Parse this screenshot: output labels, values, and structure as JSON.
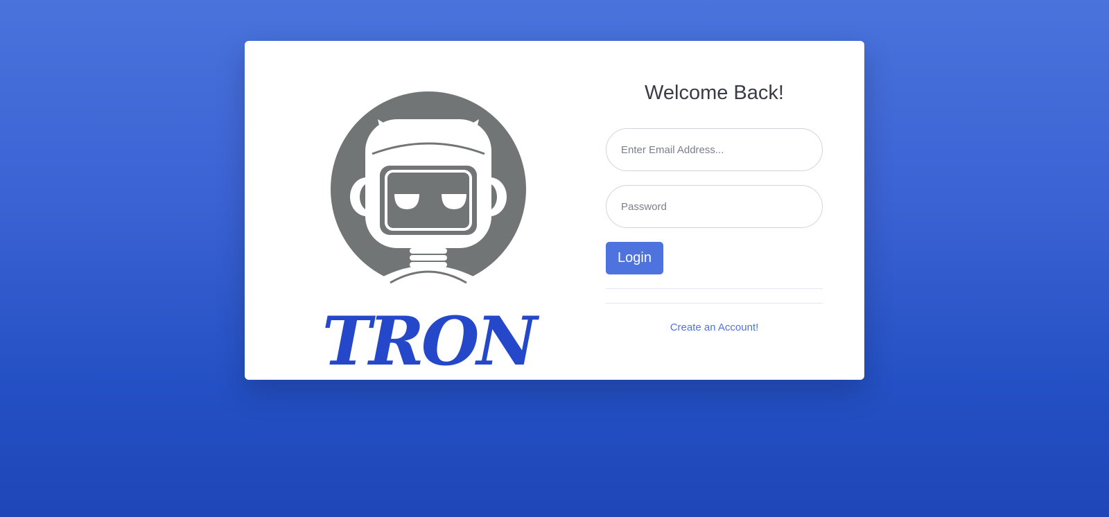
{
  "brand": {
    "name": "TRON",
    "logo_icon": "robot-mascot-icon"
  },
  "login": {
    "title": "Welcome Back!",
    "email_placeholder": "Enter Email Address...",
    "email_value": "",
    "password_placeholder": "Password",
    "password_value": "",
    "login_label": "Login",
    "create_account_label": "Create an Account!"
  },
  "colors": {
    "accent": "#4e73df",
    "background_top": "#4a73dc",
    "background_bottom": "#1f46b8",
    "logo_gray": "#717575",
    "wordmark_blue": "#2547c9"
  }
}
